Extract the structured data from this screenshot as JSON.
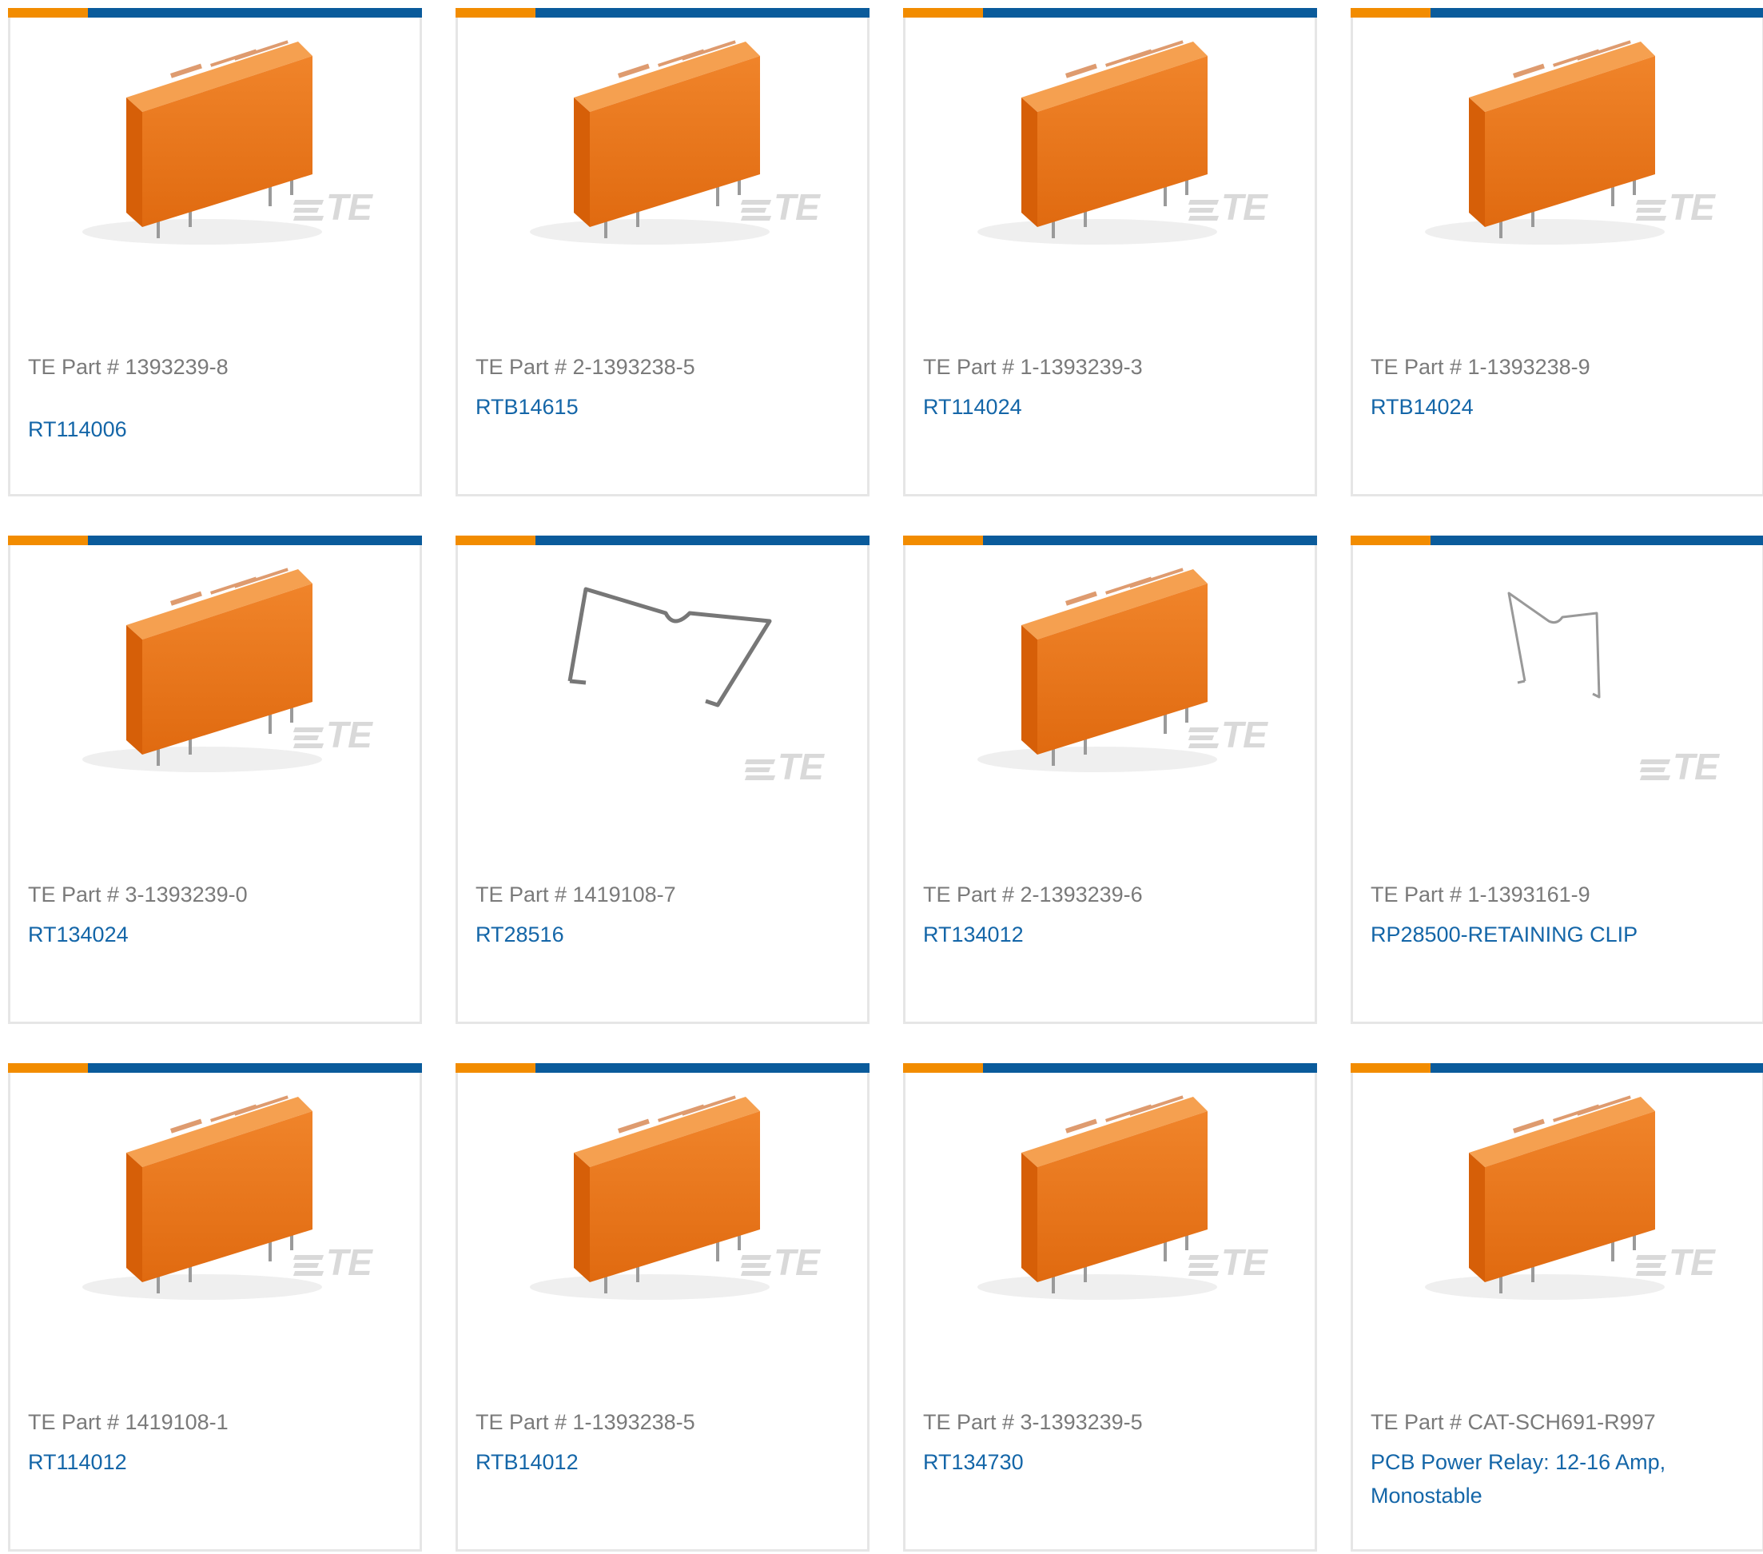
{
  "colors": {
    "accent_orange": "#f28c00",
    "accent_blue": "#0a5b9b",
    "relay_orange": "#ee7a1c",
    "link_blue": "#1466a8",
    "label_gray": "#7a7a7a"
  },
  "brand_watermark": "TE",
  "products": [
    {
      "part_number": "TE Part # 1393239-8",
      "name": "RT114006",
      "image": "relay-icon"
    },
    {
      "part_number": "TE Part # 2-1393238-5",
      "name": "RTB14615",
      "image": "relay-icon"
    },
    {
      "part_number": "TE Part # 1-1393239-3",
      "name": "RT114024",
      "image": "relay-icon"
    },
    {
      "part_number": "TE Part # 1-1393238-9",
      "name": "RTB14024",
      "image": "relay-icon"
    },
    {
      "part_number": "TE Part # 3-1393239-0",
      "name": "RT134024",
      "image": "relay-icon"
    },
    {
      "part_number": "TE Part # 1419108-7",
      "name": "RT28516",
      "image": "retaining-clip-icon"
    },
    {
      "part_number": "TE Part # 2-1393239-6",
      "name": "RT134012",
      "image": "relay-icon"
    },
    {
      "part_number": "TE Part # 1-1393161-9",
      "name": "RP28500-RETAINING CLIP",
      "image": "retaining-clip-icon"
    },
    {
      "part_number": "TE Part # 1419108-1",
      "name": "RT114012",
      "image": "relay-icon"
    },
    {
      "part_number": "TE Part # 1-1393238-5",
      "name": "RTB14012",
      "image": "relay-icon"
    },
    {
      "part_number": "TE Part # 3-1393239-5",
      "name": "RT134730",
      "image": "relay-icon"
    },
    {
      "part_number": "TE Part # CAT-SCH691-R997",
      "name": "PCB Power Relay: 12-16 Amp, Monostable",
      "image": "relay-icon"
    }
  ]
}
